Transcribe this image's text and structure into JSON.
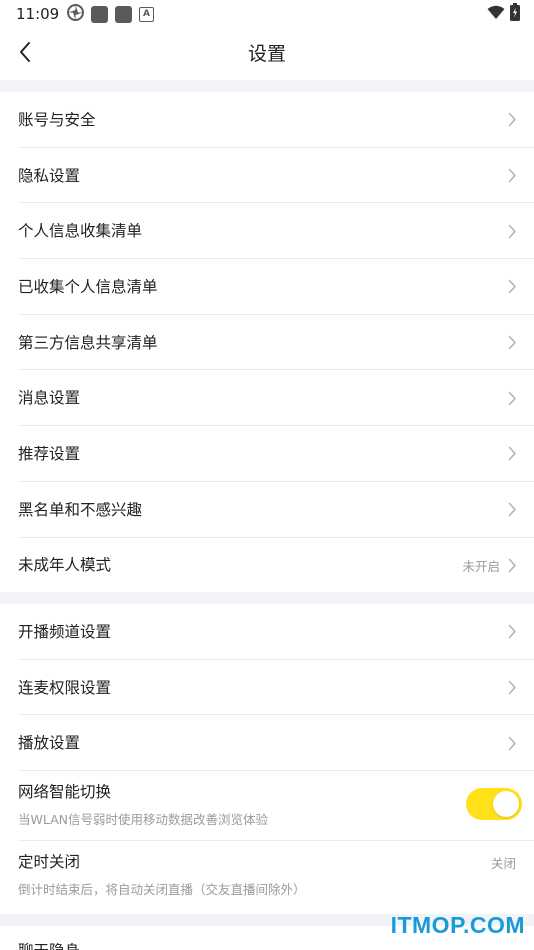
{
  "status_bar": {
    "time": "11:09",
    "left_icons": [
      "pinwheel-icon",
      "app-square-icon",
      "app-square-icon",
      "a-letter-icon"
    ],
    "a_letter": "A",
    "right_icons": [
      "wifi-icon",
      "battery-icon"
    ]
  },
  "nav": {
    "title": "设置",
    "back_icon": "chevron-left-icon"
  },
  "section1": {
    "items": [
      {
        "label": "账号与安全",
        "value": ""
      },
      {
        "label": "隐私设置",
        "value": ""
      },
      {
        "label": "个人信息收集清单",
        "value": ""
      },
      {
        "label": "已收集个人信息清单",
        "value": ""
      },
      {
        "label": "第三方信息共享清单",
        "value": ""
      },
      {
        "label": "消息设置",
        "value": ""
      },
      {
        "label": "推荐设置",
        "value": ""
      },
      {
        "label": "黑名单和不感兴趣",
        "value": ""
      },
      {
        "label": "未成年人模式",
        "value": "未开启"
      }
    ]
  },
  "section2": {
    "items": [
      {
        "label": "开播频道设置"
      },
      {
        "label": "连麦权限设置"
      },
      {
        "label": "播放设置"
      }
    ],
    "network_switch": {
      "title": "网络智能切换",
      "subtitle": "当WLAN信号弱时使用移动数据改善浏览体验",
      "enabled": true
    },
    "timer_close": {
      "title": "定时关闭",
      "subtitle": "倒计时结束后，将自动关闭直播（交友直播间除外）",
      "value": "关闭"
    }
  },
  "section3": {
    "partial_item": "聊天隐身"
  },
  "colors": {
    "toggle_on": "#ffe019",
    "separator": "#f2f3f7",
    "watermark": "#1a9bd9"
  },
  "watermark": {
    "text": "ITMOP.COM"
  }
}
